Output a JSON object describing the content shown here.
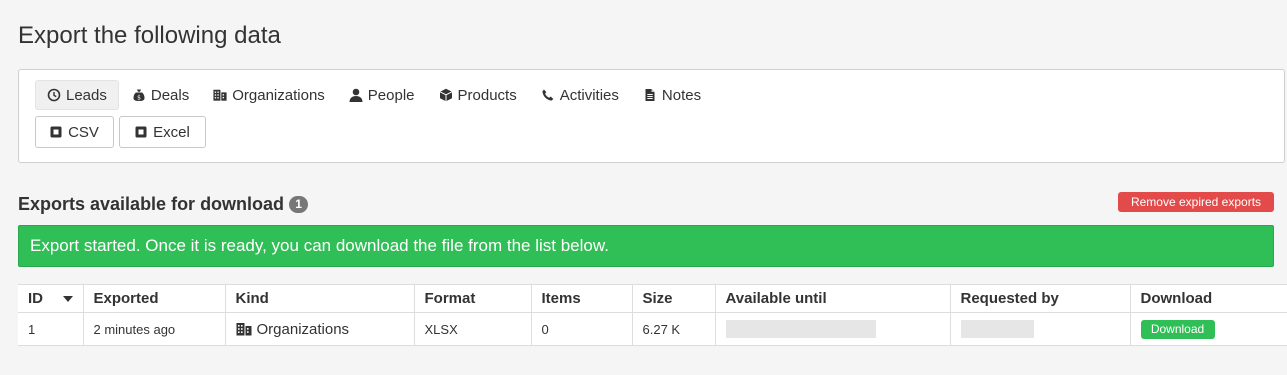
{
  "page": {
    "title": "Export the following data"
  },
  "tabs": [
    {
      "label": "Leads",
      "icon": "clock-icon",
      "active": true
    },
    {
      "label": "Deals",
      "icon": "money-bag-icon",
      "active": false
    },
    {
      "label": "Organizations",
      "icon": "building-icon",
      "active": false
    },
    {
      "label": "People",
      "icon": "person-icon",
      "active": false
    },
    {
      "label": "Products",
      "icon": "box-icon",
      "active": false
    },
    {
      "label": "Activities",
      "icon": "phone-icon",
      "active": false
    },
    {
      "label": "Notes",
      "icon": "note-icon",
      "active": false
    }
  ],
  "formats": {
    "csv_label": "CSV",
    "excel_label": "Excel"
  },
  "exports": {
    "title": "Exports available for download",
    "count": "1",
    "remove_label": "Remove expired exports",
    "alert_text": "Export started. Once it is ready, you can download the file from the list below.",
    "columns": {
      "id": "ID",
      "exported": "Exported",
      "kind": "Kind",
      "format": "Format",
      "items": "Items",
      "size": "Size",
      "available_until": "Available until",
      "requested_by": "Requested by",
      "download": "Download"
    },
    "rows": [
      {
        "id": "1",
        "exported": "2 minutes ago",
        "kind": "Organizations",
        "format": "XLSX",
        "items": "0",
        "size": "6.27 K",
        "download_label": "Download"
      }
    ]
  },
  "colors": {
    "success": "#2fbf56",
    "danger": "#e34b4b",
    "badge": "#777777"
  }
}
